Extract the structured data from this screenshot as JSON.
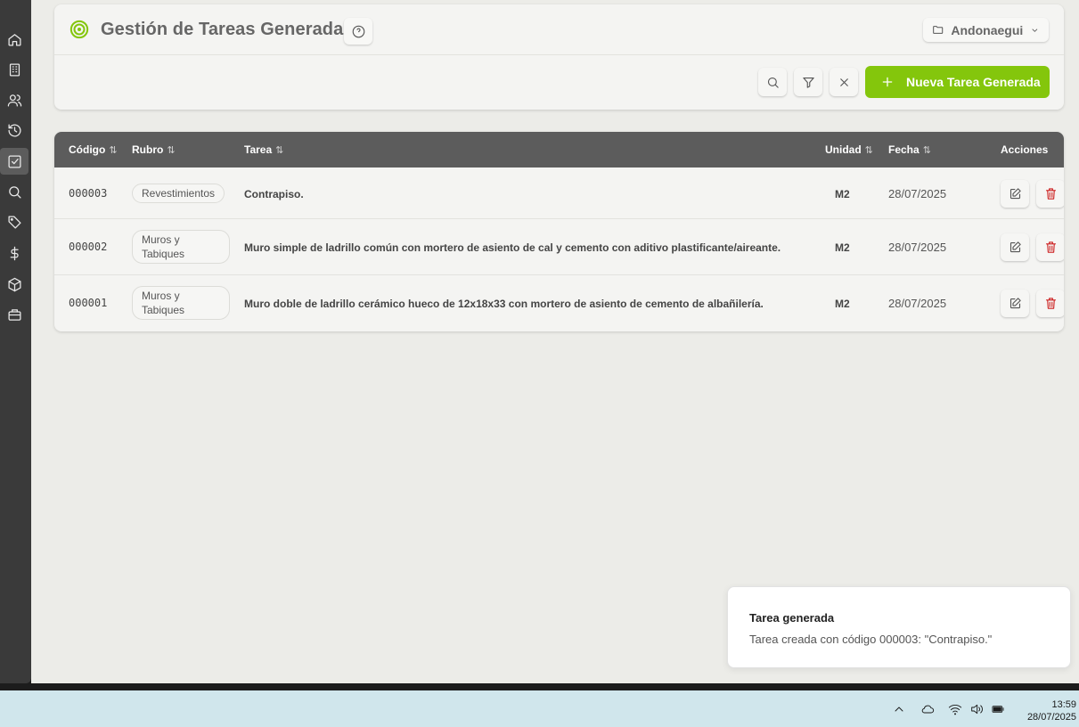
{
  "header": {
    "title": "Gestión de Tareas Generadas",
    "project": "Andonaegui",
    "new_button": "Nueva Tarea Generada"
  },
  "sidebar": {
    "items": [
      "home-icon",
      "building-icon",
      "users-icon",
      "history-icon",
      "checkbox-icon",
      "search-icon",
      "tag-icon",
      "dollar-icon",
      "package-icon",
      "briefcase-icon"
    ],
    "active": "checkbox-icon"
  },
  "table": {
    "columns": {
      "codigo": "Código",
      "rubro": "Rubro",
      "tarea": "Tarea",
      "unidad": "Unidad",
      "fecha": "Fecha",
      "acciones": "Acciones"
    },
    "rows": [
      {
        "codigo": "000003",
        "rubro": "Revestimientos",
        "tarea": "Contrapiso.",
        "unidad": "M2",
        "fecha": "28/07/2025"
      },
      {
        "codigo": "000002",
        "rubro": "Muros y Tabiques",
        "tarea": "Muro simple de ladrillo común con mortero de asiento de cal y cemento con aditivo plastificante/aireante.",
        "unidad": "M2",
        "fecha": "28/07/2025"
      },
      {
        "codigo": "000001",
        "rubro": "Muros y Tabiques",
        "tarea": "Muro doble de ladrillo cerámico hueco de 12x18x33 con mortero de asiento de cemento de albañilería.",
        "unidad": "M2",
        "fecha": "28/07/2025"
      }
    ]
  },
  "toast": {
    "title": "Tarea generada",
    "message": "Tarea creada con código 000003: \"Contrapiso.\""
  },
  "taskbar": {
    "time": "13:59",
    "date": "28/07/2025"
  },
  "colors": {
    "accent": "#84c60c",
    "table_header": "#5c5c5c",
    "delete": "#cc1f1f"
  }
}
